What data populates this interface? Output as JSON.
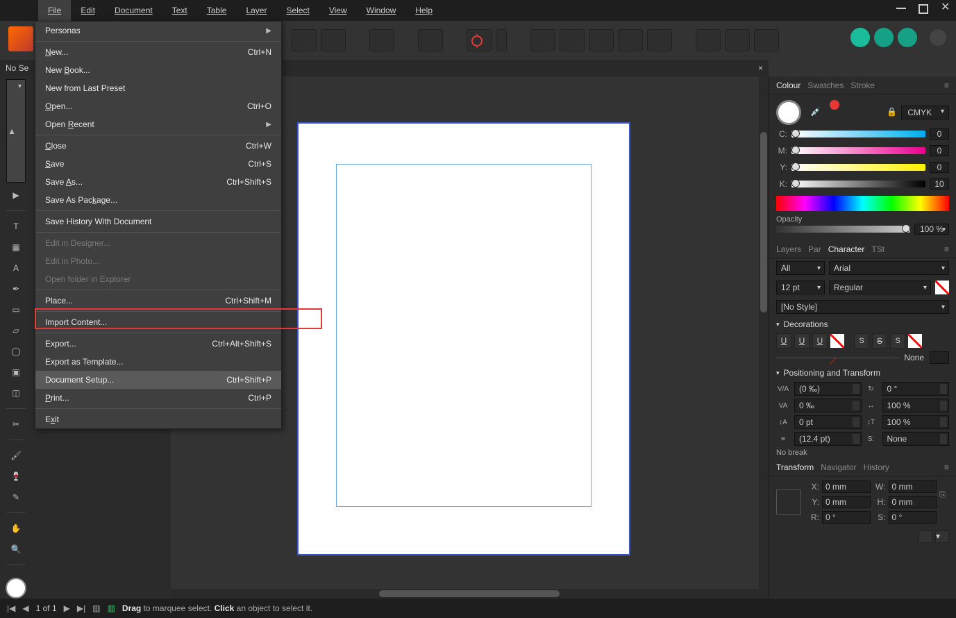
{
  "menubar": [
    "File",
    "Edit",
    "Document",
    "Text",
    "Table",
    "Layer",
    "Select",
    "View",
    "Window",
    "Help"
  ],
  "doctab": {
    "label": "No Se",
    "close": "×"
  },
  "file_menu": [
    {
      "label": "Personas",
      "sub": true
    },
    {
      "sep": true
    },
    {
      "label": "New...",
      "sc": "Ctrl+N",
      "u": "N"
    },
    {
      "label": "New Book...",
      "u": "B"
    },
    {
      "label": "New from Last Preset"
    },
    {
      "label": "Open...",
      "sc": "Ctrl+O",
      "u": "O"
    },
    {
      "label": "Open Recent",
      "sub": true,
      "u": "R"
    },
    {
      "sep": true
    },
    {
      "label": "Close",
      "sc": "Ctrl+W",
      "u": "C"
    },
    {
      "label": "Save",
      "sc": "Ctrl+S",
      "u": "S"
    },
    {
      "label": "Save As...",
      "sc": "Ctrl+Shift+S",
      "u": "A"
    },
    {
      "label": "Save As Package...",
      "u": "k"
    },
    {
      "sep": true
    },
    {
      "label": "Save History With Document"
    },
    {
      "sep": true
    },
    {
      "label": "Edit in Designer...",
      "disabled": true
    },
    {
      "label": "Edit in Photo...",
      "disabled": true
    },
    {
      "label": "Open folder in Explorer",
      "disabled": true
    },
    {
      "sep": true
    },
    {
      "label": "Place...",
      "sc": "Ctrl+Shift+M"
    },
    {
      "sep": true
    },
    {
      "label": "Import Content..."
    },
    {
      "sep": true
    },
    {
      "label": "Export...",
      "sc": "Ctrl+Alt+Shift+S"
    },
    {
      "label": "Export as Template..."
    },
    {
      "label": "Document Setup...",
      "sc": "Ctrl+Shift+P",
      "hover": true
    },
    {
      "label": "Print...",
      "sc": "Ctrl+P",
      "u": "P"
    },
    {
      "sep": true
    },
    {
      "label": "Exit",
      "u": "x"
    }
  ],
  "right": {
    "tabs1": [
      "Colour",
      "Swatches",
      "Stroke"
    ],
    "colorModel": "CMYK",
    "cmyk": [
      {
        "l": "C:",
        "v": "0"
      },
      {
        "l": "M:",
        "v": "0"
      },
      {
        "l": "Y:",
        "v": "0"
      },
      {
        "l": "K:",
        "v": "10"
      }
    ],
    "opacityLabel": "Opacity",
    "opacity": "100 %",
    "tabs2": [
      "Layers",
      "Par",
      "Character",
      "TSt"
    ],
    "filter": "All",
    "font": "Arial",
    "size": "12 pt",
    "weight": "Regular",
    "style": "[No Style]",
    "decoHdr": "Decorations",
    "decoNone": "None",
    "posHdr": "Positioning and Transform",
    "pos": {
      "kern": "(0 ‰)",
      "track": "0 ‰",
      "baseline": "0 pt",
      "leading": "(12.4 pt)",
      "rot": "0 °",
      "hscale": "100 %",
      "vscale": "100 %",
      "shear": "None"
    },
    "nobreak": "No break",
    "tabs3": [
      "Transform",
      "Navigator",
      "History"
    ],
    "tf": {
      "x": "0 mm",
      "y": "0 mm",
      "w": "0 mm",
      "h": "0 mm",
      "r": "0 °",
      "s": "0 °"
    }
  },
  "status": {
    "page": "1 of 1",
    "hint1": "Drag",
    "hint2": " to marquee select. ",
    "hint3": "Click",
    "hint4": " an object to select it."
  }
}
